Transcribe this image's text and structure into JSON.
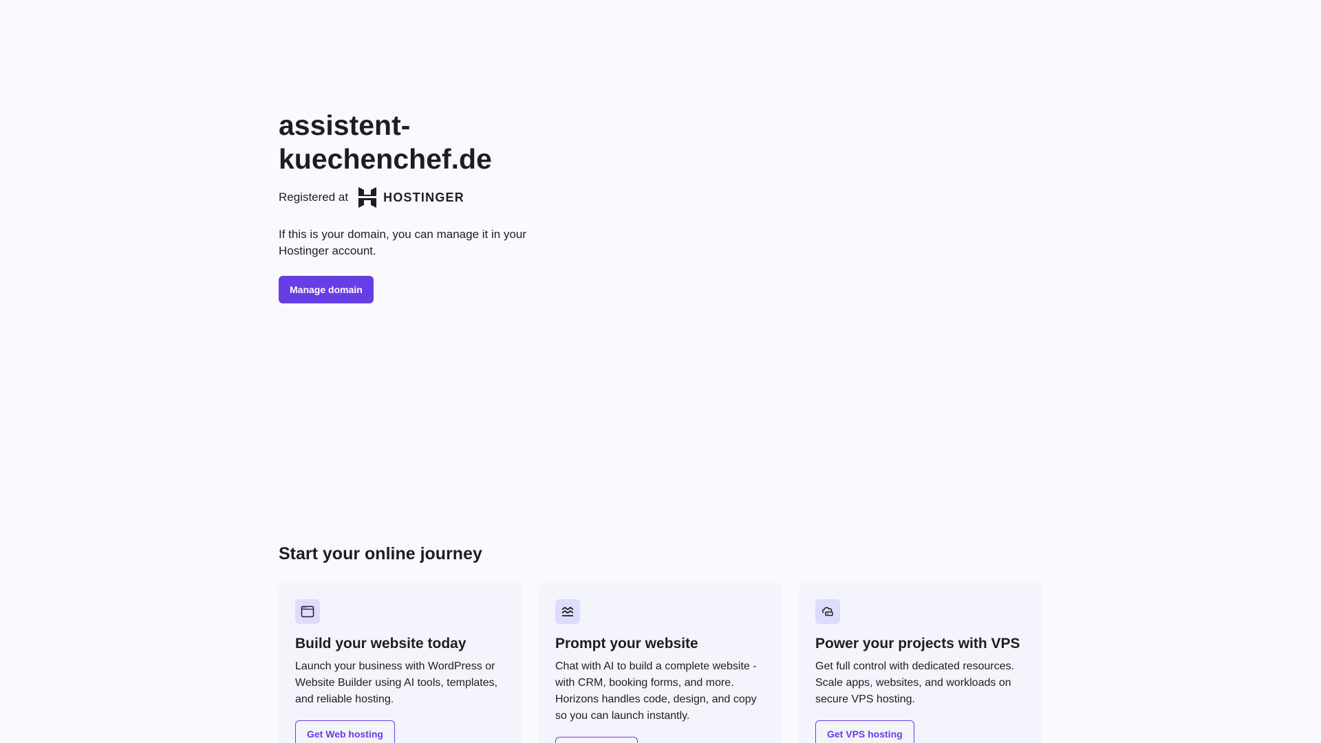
{
  "hero": {
    "domain": "assistent-kuechenchef.de",
    "registered_label": "Registered at",
    "logo_text": "HOSTINGER",
    "description": "If this is your domain, you can manage it in your Hostinger account.",
    "manage_button": "Manage domain"
  },
  "journey": {
    "title": "Start your online journey",
    "cards": [
      {
        "icon": "browser-window-icon",
        "title": "Build your website today",
        "text": "Launch your business with WordPress or Website Builder using AI tools, templates, and reliable hosting.",
        "button": "Get Web hosting"
      },
      {
        "icon": "horizons-waves-icon",
        "title": "Prompt your website",
        "text": "Chat with AI to build a complete website - with CRM, booking forms, and more. Horizons handles code, design, and copy so you can launch instantly.",
        "button": ""
      },
      {
        "icon": "cloud-server-icon",
        "title": "Power your projects with VPS",
        "text": "Get full control with dedicated resources. Scale apps, websites, and workloads on secure VPS hosting.",
        "button": "Get VPS hosting"
      }
    ]
  },
  "colors": {
    "background": "#fafafe",
    "accent": "#673de6",
    "card_background": "#f4f4fc",
    "icon_background": "#dedcfc",
    "text": "#1d1e20"
  }
}
